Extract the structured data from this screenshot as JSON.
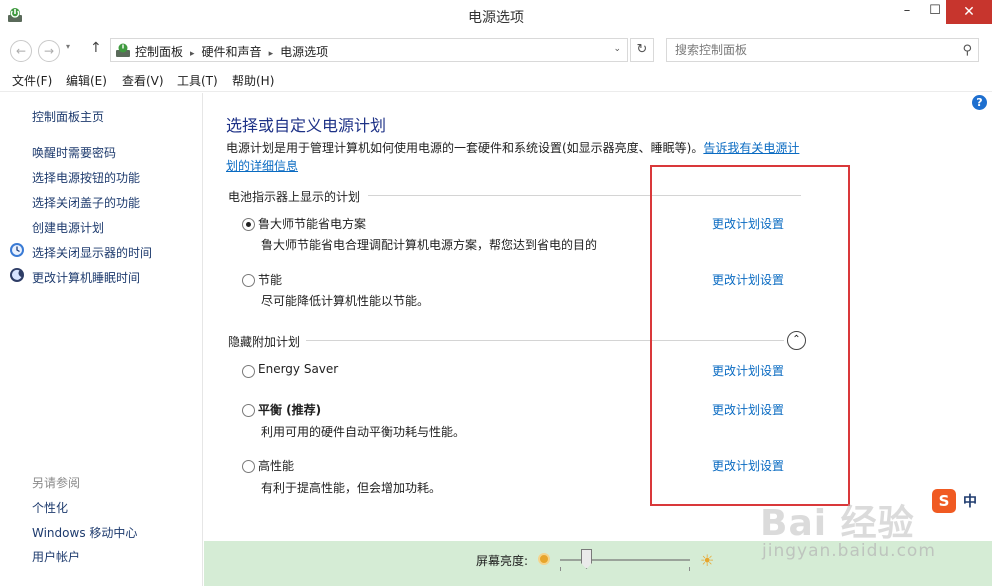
{
  "window": {
    "title": "电源选项",
    "min_glyph": "–",
    "max_glyph": "☐",
    "close_glyph": "✕"
  },
  "address": {
    "back_glyph": "←",
    "forward_glyph": "→",
    "history_glyph": "▾",
    "up_glyph": "↑",
    "crumbs": [
      "控制面板",
      "硬件和声音",
      "电源选项"
    ],
    "crumb_sep": "▸",
    "dropdown_glyph": "⌄",
    "refresh_glyph": "↻",
    "search_placeholder": "搜索控制面板",
    "search_glyph": "⚲"
  },
  "menu": {
    "items": [
      "文件(F)",
      "编辑(E)",
      "查看(V)",
      "工具(T)",
      "帮助(H)"
    ]
  },
  "sidebar": {
    "home": "控制面板主页",
    "links": [
      "唤醒时需要密码",
      "选择电源按钮的功能",
      "选择关闭盖子的功能",
      "创建电源计划",
      "选择关闭显示器的时间",
      "更改计算机睡眠时间"
    ],
    "see_also_title": "另请参阅",
    "see_also": [
      "个性化",
      "Windows 移动中心",
      "用户帐户"
    ]
  },
  "main": {
    "title": "选择或自定义电源计划",
    "description": "电源计划是用于管理计算机如何使用电源的一套硬件和系统设置(如显示器亮度、睡眠等)。",
    "learn_more": "告诉我有关电源计划的详细信息",
    "battery_section": "电池指示器上显示的计划",
    "hidden_section": "隐藏附加计划",
    "collapse_glyph": "⌃",
    "change_label": "更改计划设置",
    "plans": [
      {
        "name": "鲁大师节能省电方案",
        "desc": "鲁大师节能省电合理调配计算机电源方案，帮您达到省电的目的",
        "selected": true
      },
      {
        "name": "节能",
        "desc": "尽可能降低计算机性能以节能。",
        "selected": false
      },
      {
        "name": "Energy Saver",
        "desc": "",
        "selected": false
      },
      {
        "name": "平衡 (推荐)",
        "desc": "利用可用的硬件自动平衡功耗与性能。",
        "selected": false
      },
      {
        "name": "高性能",
        "desc": "有利于提高性能，但会增加功耗。",
        "selected": false
      }
    ],
    "help_glyph": "?"
  },
  "bottom": {
    "brightness_label": "屏幕亮度:",
    "brightness_level": 0.2,
    "sun_glyph": "☀"
  },
  "ime": {
    "logo": "S",
    "lang": "中"
  },
  "watermark": {
    "text": "Bai 经验",
    "url": "jingyan.baidu.com"
  },
  "colors": {
    "link": "#0a6bc2",
    "title": "#1e3287",
    "highlight": "#d9383a",
    "bottom_bar": "#d5ecd5",
    "close_button": "#c7352d"
  }
}
